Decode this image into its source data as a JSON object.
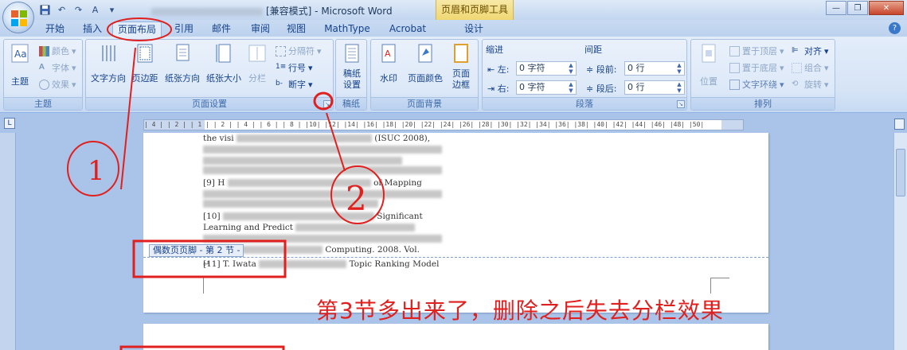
{
  "titlebar": {
    "title_prefix": "[兼容模式] - Microsoft Word",
    "context_tab": "页眉和页脚工具",
    "qat_undo": "↶",
    "qat_redo": "↷",
    "qat_font": "A",
    "win_minimize": "—",
    "win_restore": "❐",
    "win_close": "✕"
  },
  "tabs": [
    {
      "label": "开始"
    },
    {
      "label": "插入"
    },
    {
      "label": "页面布局"
    },
    {
      "label": "引用"
    },
    {
      "label": "邮件"
    },
    {
      "label": "审阅"
    },
    {
      "label": "视图"
    },
    {
      "label": "MathType"
    },
    {
      "label": "Acrobat"
    },
    {
      "label": "设计"
    }
  ],
  "ribbon": {
    "theme": {
      "label": "主题",
      "big": "主题",
      "colors": "颜色",
      "fonts": "字体",
      "effects": "效果"
    },
    "page_setup": {
      "label": "页面设置",
      "text_dir": "文字方向",
      "margins": "页边距",
      "orientation": "纸张方向",
      "size": "纸张大小",
      "columns": "分栏",
      "breaks": "分隔符",
      "line_numbers": "行号",
      "hyphenation": "断字"
    },
    "manuscript": {
      "label": "稿纸",
      "btn": "稿纸\n设置",
      "btn_line1": "稿纸",
      "btn_line2": "设置"
    },
    "page_bg": {
      "label": "页面背景",
      "watermark": "水印",
      "page_color": "页面颜色",
      "page_border_1": "页面",
      "page_border_2": "边框"
    },
    "paragraph": {
      "label": "段落",
      "indent": "缩进",
      "spacing": "间距",
      "left": "左:",
      "right": "右:",
      "before": "段前:",
      "after": "段后:",
      "left_val": "0 字符",
      "right_val": "0 字符",
      "before_val": "0 行",
      "after_val": "0 行"
    },
    "arrange": {
      "label": "排列",
      "position": "位置",
      "bring_front": "置于顶层",
      "send_back": "置于底层",
      "text_wrap": "文字环绕",
      "align": "对齐",
      "group": "组合",
      "rotate": "旋转"
    }
  },
  "ruler": {
    "marks": "| 4 |   | 2 |   | 1 |   | 2 |   | 4 |   | 6 |   | 8 |   |10|   |12|   |14|   |16|   |18|   |20|   |22|   |24|   |26|   |28|   |30|   |32|   |34|   |36|   |38|   |40|   |42|   |44|   |46|   |48|   |50|"
  },
  "document": {
    "refs": [
      {
        "txt": "the visi",
        "tail": "(ISUC 2008),"
      },
      {
        "txt": "Symp",
        "tail": ""
      },
      {
        "txt": "[9] H",
        "tail": "of Mapping"
      },
      {
        "txt": "the",
        "tail": "Cost on World"
      },
      {
        "txt": "[10]",
        "tail": "Significant"
      },
      {
        "txt": "Learning and Predict",
        "tail": ""
      },
      {
        "txt": "",
        "tail": "Computing. 2008. Vol."
      },
      {
        "txt": "[11] T. Iwata",
        "tail": "Topic Ranking Model"
      }
    ],
    "footer_label": "偶数页页脚 - 第 2 节 -",
    "para_mark": "↵"
  },
  "annotations": {
    "circle1": "①",
    "circle2": "②",
    "note": "第3节多出来了，删除之后失去分栏效果",
    "red": "#e0201e"
  }
}
